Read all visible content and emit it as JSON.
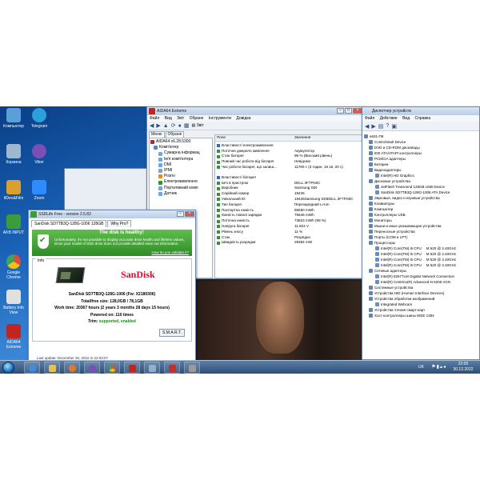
{
  "desktop": {
    "icons": [
      {
        "label": "Компьютер",
        "color": "#5aa0d8"
      },
      {
        "label": "Telegram",
        "color": "#2aa1da"
      },
      {
        "label": "Корзина",
        "color": "#9fb8d0"
      },
      {
        "label": "Viber",
        "color": "#7b4fb8"
      },
      {
        "label": "ItDeo&Film",
        "color": "#d9a030"
      },
      {
        "label": "Zoom",
        "color": "#2d8cff"
      },
      {
        "label": "AKB INPUT",
        "color": "#3a9d3a"
      },
      {
        "label": "Google Chrome",
        "color": "#e04a3a"
      },
      {
        "label": "Battery Info View",
        "color": "#e0e0e0"
      },
      {
        "label": "AIDA64 Extreme",
        "color": "#c0261f"
      }
    ]
  },
  "aida": {
    "title": "AIDA64 Extreme",
    "menu": [
      "Файл",
      "Вид",
      "Звіт",
      "Обране",
      "Інструменти",
      "Довідка"
    ],
    "toolbar_label": "Звіт",
    "tabs": [
      "Меню",
      "Обране"
    ],
    "tree": [
      "AIDA64 v6.28.5300",
      "Комп'ютер",
      "Сумарна інформац",
      "Ім'я комп'ютера",
      "DMI",
      "IPMI",
      "Розгін",
      "Електроживлення",
      "Портативний комп",
      "Датчик"
    ],
    "columns": [
      "Поле",
      "Значення"
    ],
    "section1": "Властивості електроживлення",
    "rows1": [
      [
        "Поточне джерело живлення",
        "Акумулятор"
      ],
      [
        "Стан батареї",
        "98 % (Високий рівень)"
      ],
      [
        "Повний час роботи від батареї",
        "Невідомо"
      ],
      [
        "Час роботи батареї, що залиш...",
        "11780 с (3 годин, 16 хв, 20 с)"
      ]
    ],
    "section2": "Властивості батареї",
    "rows2": [
      [
        "Ім'я в пристрою",
        "DELL 3F7FN0C"
      ],
      [
        "Виробник",
        "Samsung SDI"
      ],
      [
        "Серійний номер",
        "19426"
      ],
      [
        "Унікальний ID",
        "19426Samsung SDIDELL 3F7FN0C"
      ],
      [
        "Тип батареї",
        "Перезарядний Li-Ion"
      ],
      [
        "Паспортна ємність",
        "85650 mWh"
      ],
      [
        "Ємність повної зарядки",
        "75645 mWh"
      ],
      [
        "Поточна ємність",
        "73823 mWh  (98 %)"
      ],
      [
        "Напруга батареї",
        "11.924 V"
      ],
      [
        "Рівень зносу",
        "11 %"
      ],
      [
        "Стан",
        "Розрядка"
      ],
      [
        "Швидкість розрядки",
        "29384 mW"
      ]
    ]
  },
  "devmgr": {
    "title": "Диспетчер устройств",
    "menu": [
      "Файл",
      "Действие",
      "Вид",
      "Справка"
    ],
    "nodes": [
      {
        "level": 0,
        "label": "e631-ПК"
      },
      {
        "level": 1,
        "label": "ControlVault Device"
      },
      {
        "level": 1,
        "label": "DVD и CD-ROM дисководы"
      },
      {
        "level": 1,
        "label": "IDE ATA/ATAPI контроллеры"
      },
      {
        "level": 1,
        "label": "PCMCIA адаптеры"
      },
      {
        "level": 1,
        "label": "Батареи"
      },
      {
        "level": 1,
        "label": "Видеоадаптеры"
      },
      {
        "level": 2,
        "label": "Intel(R) HD Graphics"
      },
      {
        "level": 1,
        "label": "Дисковые устройства"
      },
      {
        "level": 2,
        "label": "JetFlash Transcend 128GB USB Device"
      },
      {
        "level": 2,
        "label": "SanDisk SD7TB3Q-128G-1006 ATA Device"
      },
      {
        "level": 1,
        "label": "Звуковые, видео и игровые устройства"
      },
      {
        "level": 1,
        "label": "Клавиатуры"
      },
      {
        "level": 1,
        "label": "Компьютер"
      },
      {
        "level": 1,
        "label": "Контроллеры USB"
      },
      {
        "level": 1,
        "label": "Мониторы"
      },
      {
        "level": 1,
        "label": "Мыши и иные указывающие устройства"
      },
      {
        "level": 1,
        "label": "Переносные устройства"
      },
      {
        "level": 1,
        "label": "Порты (COM и LPT)"
      },
      {
        "level": 1,
        "label": "Процессоры"
      },
      {
        "level": 2,
        "label": "Intel(R) Core(TM) i5 CPU",
        "extra": "M 520 @ 2.40GHz"
      },
      {
        "level": 2,
        "label": "Intel(R) Core(TM) i5 CPU",
        "extra": "M 520 @ 2.40GHz"
      },
      {
        "level": 2,
        "label": "Intel(R) Core(TM) i5 CPU",
        "extra": "M 520 @ 2.40GHz"
      },
      {
        "level": 2,
        "label": "Intel(R) Core(TM) i5 CPU",
        "extra": "M 520 @ 2.40GHz"
      },
      {
        "level": 1,
        "label": "Сетевые адаптеры"
      },
      {
        "level": 2,
        "label": "Intel(R) 82577LM Gigabit Network Connection"
      },
      {
        "level": 2,
        "label": "Intel(R) Centrino(R) Advanced-N 6200 AGN"
      },
      {
        "level": 1,
        "label": "Системные устройства"
      },
      {
        "level": 1,
        "label": "Устройства HID (Human Interface Devices)"
      },
      {
        "level": 1,
        "label": "Устройства обработки изображений"
      },
      {
        "level": 2,
        "label": "Integrated Webcam"
      },
      {
        "level": 1,
        "label": "Устройства чтения смарт-карт"
      },
      {
        "level": 1,
        "label": "Хост-контроллеры шины IEEE 1394"
      }
    ]
  },
  "ssdlife": {
    "title": "SSDLife Free - version 2.5.82",
    "tabs": [
      "SanDisk SD7TB3Q-128G-1006 128GB",
      "Why Pro?"
    ],
    "health_title": "The disk is healthy!",
    "health_text": "Unfortunately, it's not possible to display accurate drive health and lifetime values, since your model of SSD drive does not provide detailed wear out information.",
    "health_link": "How do you validate it?",
    "info_legend": "Info",
    "brand": "SanDisk",
    "model_line": "SanDisk SD7TB3Q-128G-1006 (Fw: X2180306)",
    "free_line": "Total/free size: 128,0GB / 78,1GB",
    "work_time": "Work time: 20367 hours (2 years 3 months 28 days 15 hours)",
    "powered_on": "Powered on: 110 times",
    "trim_label": "Trim:",
    "trim_value": "supported, enabled",
    "smart_button": "S.M.A.R.T.",
    "last_update": "Last update: December 30, 2022 in 22:03:07"
  },
  "taskbar": {
    "lang": "UK",
    "time": "22:05",
    "date": "30.12.2022"
  }
}
